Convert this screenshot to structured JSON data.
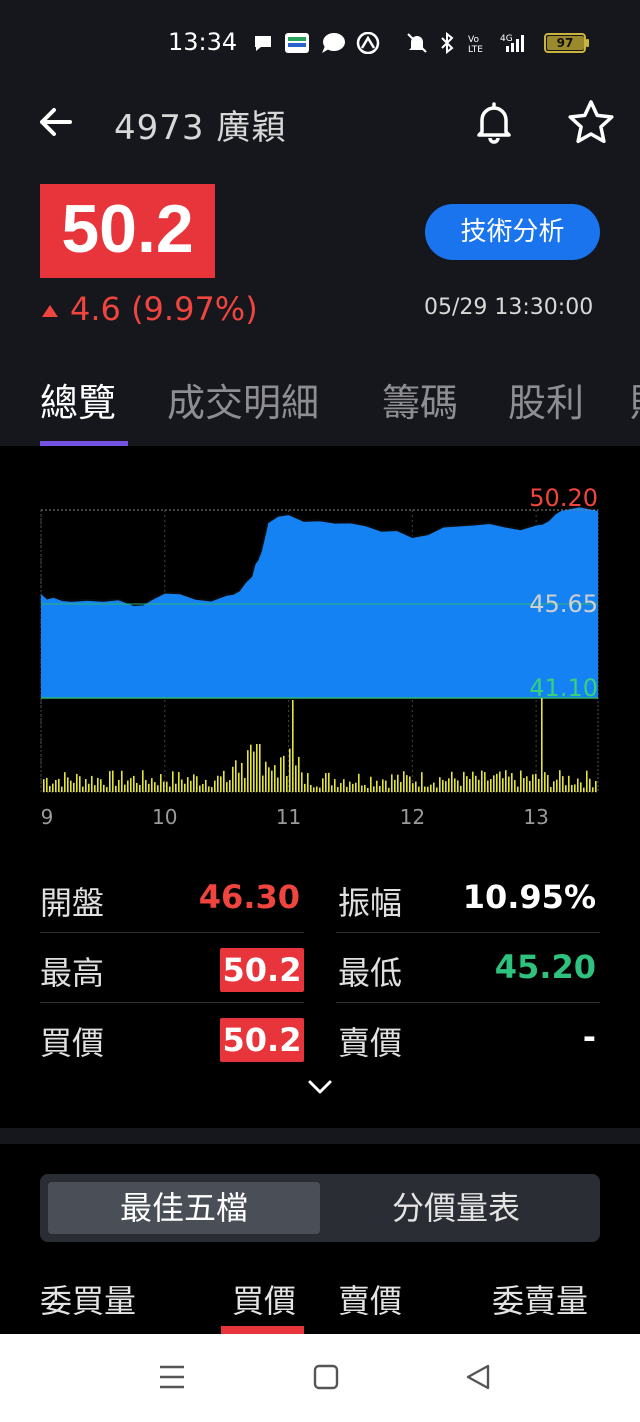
{
  "status_bar": {
    "time": "13:34",
    "battery": "97",
    "icons": [
      "chat-bubble-icon",
      "wallet-app-icon",
      "messenger-icon",
      "app-icon",
      "mute-icon",
      "bluetooth-icon",
      "volte-icon",
      "signal-4g-icon",
      "battery-icon"
    ]
  },
  "header": {
    "title": "4973 廣穎",
    "back_icon": "arrow-left-icon",
    "bell_icon": "bell-icon",
    "star_icon": "star-icon"
  },
  "quote": {
    "price": "50.2",
    "change": "4.6 (9.97%)",
    "direction": "up",
    "technical_button": "技術分析",
    "timestamp": "05/29 13:30:00"
  },
  "tabs": [
    {
      "label": "總覽",
      "active": true
    },
    {
      "label": "成交明細",
      "active": false
    },
    {
      "label": "籌碼",
      "active": false
    },
    {
      "label": "股利",
      "active": false
    },
    {
      "label": "財",
      "active": false
    }
  ],
  "chart_data": {
    "type": "area",
    "price_axis_labels": {
      "high": "50.20",
      "mid": "45.65",
      "low": "41.10"
    },
    "ylim": [
      41.1,
      50.2
    ],
    "x_labels": [
      "9",
      "10",
      "11",
      "12",
      "13"
    ],
    "price_series": {
      "x": [
        9.0,
        9.1,
        9.25,
        9.5,
        9.75,
        9.9,
        10.0,
        10.25,
        10.5,
        10.6,
        10.7,
        10.75,
        10.8,
        10.83,
        11.0,
        11.25,
        11.5,
        11.75,
        12.0,
        12.25,
        12.5,
        12.75,
        13.0,
        13.1,
        13.2,
        13.5
      ],
      "y": [
        46.2,
        46.0,
        45.8,
        45.8,
        45.6,
        45.9,
        46.2,
        45.9,
        46.1,
        46.3,
        47.0,
        47.8,
        48.8,
        49.6,
        50.0,
        49.7,
        49.6,
        49.2,
        48.9,
        49.4,
        49.5,
        49.4,
        49.5,
        49.7,
        50.2,
        50.2
      ]
    },
    "volume_colors": {
      "price_fill": "#1582f3",
      "volume": "#e4e43a",
      "high_label": "#f0453f",
      "mid_label": "#cfcfcf",
      "low_label": "#37d17a"
    }
  },
  "stats": {
    "open_label": "開盤",
    "open_value": "46.30",
    "amplitude_label": "振幅",
    "amplitude_value": "10.95%",
    "high_label": "最高",
    "high_value": "50.2",
    "low_label": "最低",
    "low_value": "45.20",
    "bid_label": "買價",
    "bid_value": "50.2",
    "ask_label": "賣價",
    "ask_value": "-"
  },
  "order_book": {
    "segments": [
      {
        "label": "最佳五檔",
        "active": true
      },
      {
        "label": "分價量表",
        "active": false
      }
    ],
    "columns": [
      "委買量",
      "買價",
      "賣價",
      "委賣量"
    ]
  },
  "nav": {
    "icons": [
      "menu-icon",
      "home-square-icon",
      "back-triangle-icon"
    ]
  }
}
